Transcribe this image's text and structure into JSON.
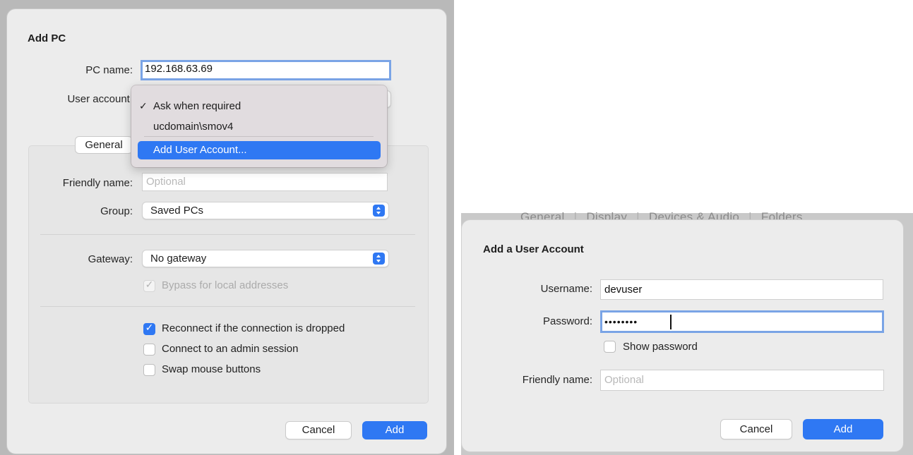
{
  "add_pc": {
    "title": "Add PC",
    "pc_name_label": "PC name:",
    "pc_name_value": "192.168.63.69",
    "user_account_label": "User account:",
    "menu": {
      "checked_item": "Ask when required",
      "item2": "ucdomain\\smov4",
      "highlighted_item": "Add User Account..."
    },
    "tab_general": "General",
    "friendly_name_label": "Friendly name:",
    "friendly_name_placeholder": "Optional",
    "group_label": "Group:",
    "group_value": "Saved PCs",
    "gateway_label": "Gateway:",
    "gateway_value": "No gateway",
    "bypass_label": "Bypass for local addresses",
    "reconnect_label": "Reconnect if the connection is dropped",
    "admin_label": "Connect to an admin session",
    "swap_label": "Swap mouse buttons",
    "cancel_label": "Cancel",
    "add_label": "Add"
  },
  "add_user": {
    "background_tabs": [
      "General",
      "Display",
      "Devices & Audio",
      "Folders"
    ],
    "title": "Add a User Account",
    "username_label": "Username:",
    "username_value": "devuser",
    "password_label": "Password:",
    "password_value": "••••••••",
    "show_password_label": "Show password",
    "friendly_name_label": "Friendly name:",
    "friendly_name_placeholder": "Optional",
    "cancel_label": "Cancel",
    "add_label": "Add"
  },
  "colors": {
    "accent": "#2f78f3",
    "focus_ring": "#7aa4e6",
    "menu_bg": "#e1dcdf",
    "sheet_bg": "#ececec"
  }
}
